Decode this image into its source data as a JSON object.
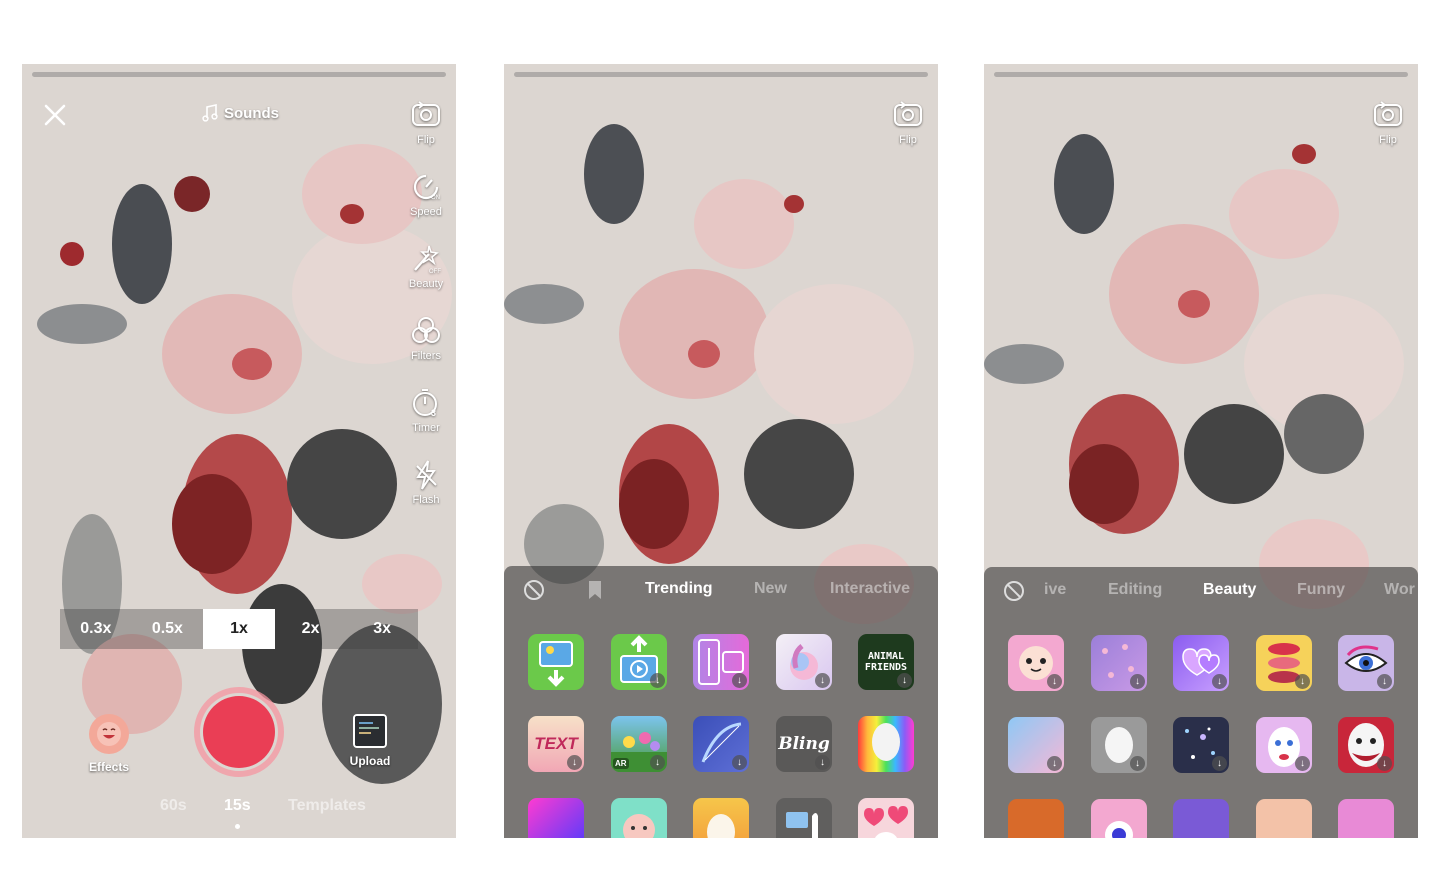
{
  "screen1": {
    "top_bar": {
      "sounds_label": "Sounds"
    },
    "sidebar": [
      {
        "label": "Flip",
        "icon": "flip-camera-icon"
      },
      {
        "label": "Speed",
        "icon": "speed-icon",
        "badge": "ON"
      },
      {
        "label": "Beauty",
        "icon": "beauty-wand-icon",
        "badge": "OFF"
      },
      {
        "label": "Filters",
        "icon": "filters-icon"
      },
      {
        "label": "Timer",
        "icon": "timer-icon",
        "badge": "3"
      },
      {
        "label": "Flash",
        "icon": "flash-icon"
      }
    ],
    "speed_options": [
      "0.3x",
      "0.5x",
      "1x",
      "2x",
      "3x"
    ],
    "speed_selected": "1x",
    "effects_label": "Effects",
    "upload_label": "Upload",
    "modes": [
      "60s",
      "15s",
      "Templates"
    ],
    "mode_selected": "15s",
    "record_color": "#ea3e55"
  },
  "screen2": {
    "flip_label": "Flip",
    "tabs": [
      "Trending",
      "New",
      "Interactive"
    ],
    "tab_selected": "Trending",
    "tile_texts": {
      "animal_friends": "ANIMAL FRIENDS",
      "text_tile": "TEXT",
      "bling": "Bling",
      "ar_badge": "AR"
    }
  },
  "screen3": {
    "flip_label": "Flip",
    "tabs": [
      "ive",
      "Editing",
      "Beauty",
      "Funny",
      "Wor"
    ],
    "tab_selected": "Beauty"
  }
}
